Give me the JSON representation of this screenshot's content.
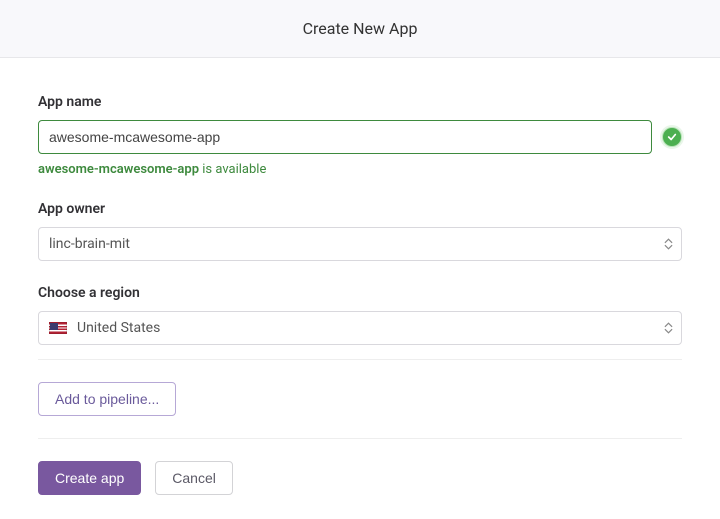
{
  "header": {
    "title": "Create New App"
  },
  "app_name": {
    "label": "App name",
    "value": "awesome-mcawesome-app",
    "availability_name": "awesome-mcawesome-app",
    "availability_suffix": " is available"
  },
  "app_owner": {
    "label": "App owner",
    "selected": "linc-brain-mit"
  },
  "region": {
    "label": "Choose a region",
    "selected": "United States"
  },
  "pipeline_button": "Add to pipeline...",
  "actions": {
    "create": "Create app",
    "cancel": "Cancel"
  }
}
